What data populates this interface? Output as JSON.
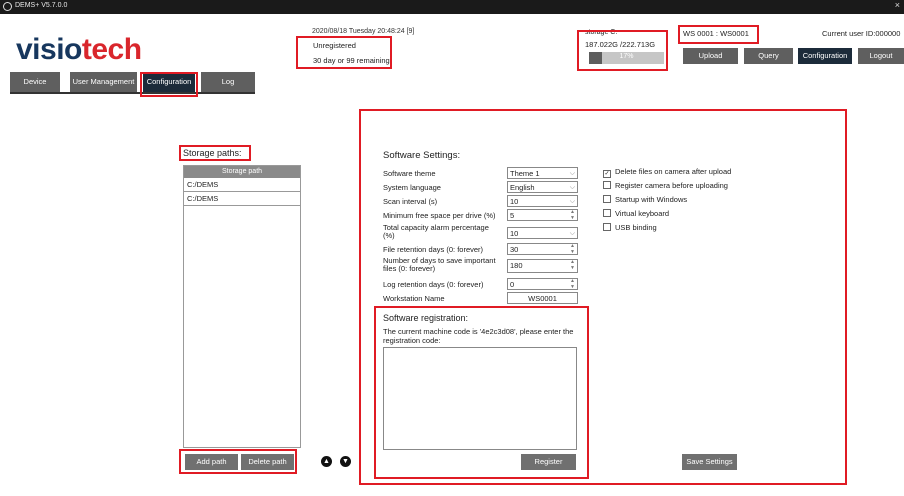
{
  "titlebar": {
    "title": "DEMS+ V5.7.0.0",
    "close": "×"
  },
  "logo": {
    "part1": "visio",
    "part2": "tech"
  },
  "status": {
    "datetime": "2020/08/18 Tuesday 20:48:24 [9]",
    "registration": "Unregistered",
    "remaining": "30 day or 99 remaining"
  },
  "storage": {
    "label": "storage C:",
    "size": "187.022G /222.713G",
    "percent": "17%",
    "fraction": 0.17
  },
  "workstation": {
    "id": "WS 0001 : WS0001"
  },
  "user": {
    "id_text": "Current user ID:000000"
  },
  "header_buttons": {
    "upload": "Upload",
    "query": "Query",
    "configuration": "Configuration",
    "logout": "Logout"
  },
  "tabs": {
    "device": "Device",
    "user_management": "User Management",
    "configuration": "Configuration",
    "log": "Log"
  },
  "storage_paths": {
    "title": "Storage paths:",
    "column": "Storage path",
    "rows": [
      "C:/DEMS",
      "C:/DEMS"
    ],
    "add": "Add path",
    "delete": "Delete path",
    "up": "▲",
    "down": "▼"
  },
  "settings": {
    "title": "Software Settings:",
    "theme_label": "Software theme",
    "theme_value": "Theme 1",
    "language_label": "System language",
    "language_value": "English",
    "scan_label": "Scan interval (s)",
    "scan_value": "10",
    "minfree_label": "Minimum free space per drive (%)",
    "minfree_value": "5",
    "alarm_label": "Total capacity alarm percentage (%)",
    "alarm_value": "10",
    "retention_label": "File retention days (0: forever)",
    "retention_value": "30",
    "important_label": "Number of days to save important files (0: forever)",
    "important_value": "180",
    "logret_label": "Log retention days (0: forever)",
    "logret_value": "0",
    "wsname_label": "Workstation Name",
    "wsname_value": "WS0001",
    "save": "Save Settings"
  },
  "checkboxes": [
    {
      "label": "Delete files on camera after upload",
      "checked": true
    },
    {
      "label": "Register camera before uploading",
      "checked": false
    },
    {
      "label": "Startup with Windows",
      "checked": false
    },
    {
      "label": "Virtual keyboard",
      "checked": false
    },
    {
      "label": "USB binding",
      "checked": false
    }
  ],
  "registration": {
    "title": "Software registration:",
    "message": "The current machine code is '4e2c3d08', please enter the registration code:",
    "button": "Register"
  },
  "icons": {
    "dropdown": "chevron-down-icon",
    "spinner": "spinner-icon",
    "check": "check-icon"
  },
  "colors": {
    "highlight": "#e01b24",
    "logo_dark": "#17375e",
    "logo_red": "#d9262c",
    "button": "#5f5f5f",
    "button_active": "#1c2b3a"
  }
}
